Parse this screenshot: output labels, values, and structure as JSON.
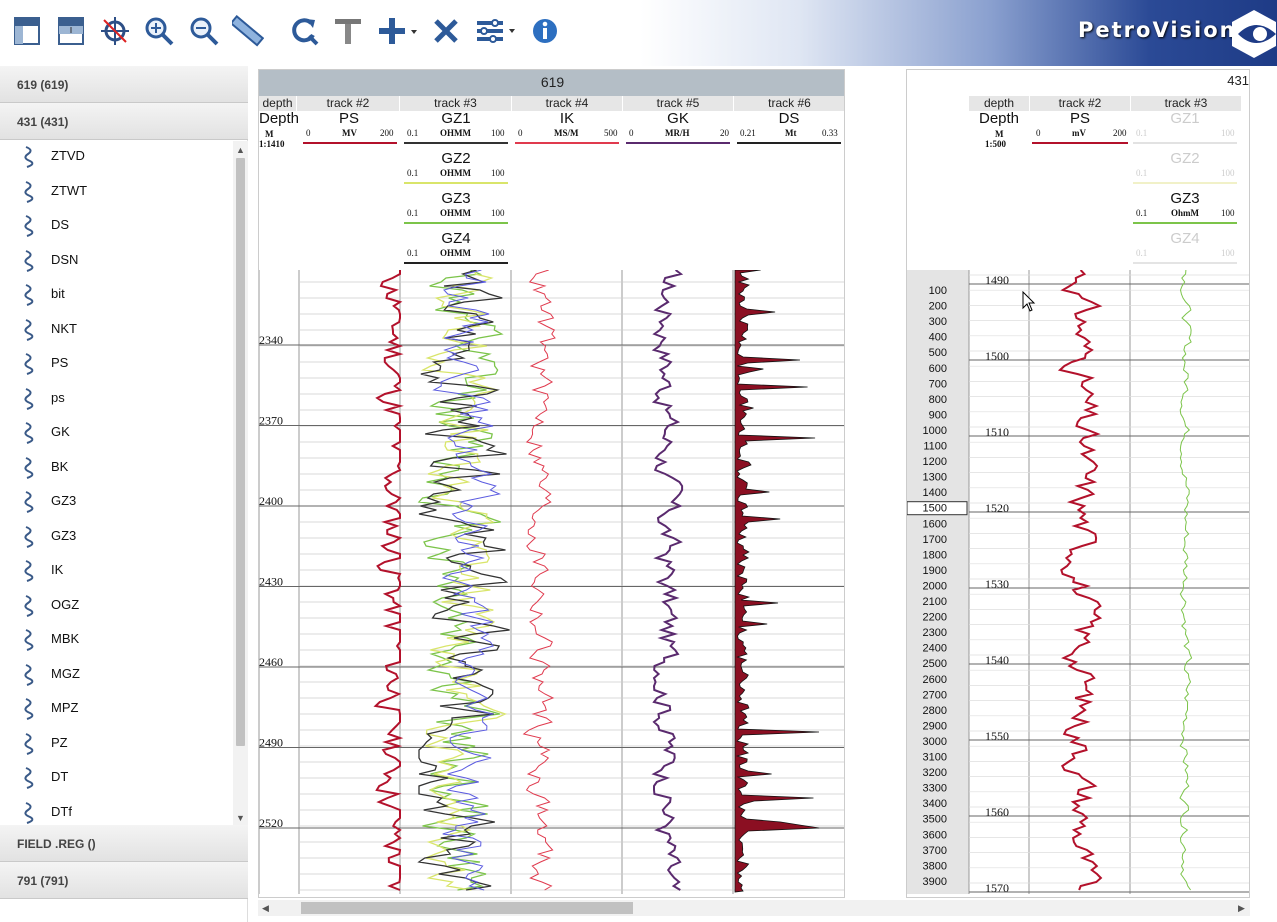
{
  "app": {
    "brand": "PetroVision"
  },
  "toolbar": {
    "icons": [
      "panel-left-icon",
      "panel-top-icon",
      "target-icon",
      "zoom-in-icon",
      "zoom-out-icon",
      "ruler-icon",
      "refresh-icon",
      "align-top-icon",
      "add-icon",
      "close-icon",
      "settings-list-icon",
      "info-icon"
    ]
  },
  "sidebar": {
    "groups": [
      {
        "label": "619 (619)"
      },
      {
        "label": "431 (431)"
      },
      {
        "label": "FIELD .REG ()"
      },
      {
        "label": "791 (791)"
      }
    ],
    "items": [
      "ZTVD",
      "ZTWT",
      "DS",
      "DSN",
      "bit",
      "NKT",
      "PS",
      "ps",
      "GK",
      "BK",
      "GZ3",
      "GZ3",
      "IK",
      "OGZ",
      "MBK",
      "MGZ",
      "MPZ",
      "PZ",
      "DT",
      "DTf"
    ]
  },
  "panel1": {
    "title": "619",
    "tracks": [
      "depth",
      "track #2",
      "track #3",
      "track #4",
      "track #5",
      "track #6"
    ],
    "depth_header": {
      "name": "Depth",
      "unit": "M",
      "scale": "1:1410"
    },
    "curves": [
      {
        "name": "PS",
        "min": "0",
        "unit": "MV",
        "max": "200",
        "color": "#b3112b"
      },
      {
        "name": "GZ1",
        "min": "0.1",
        "unit": "OHMM",
        "max": "100",
        "color": "#333333"
      },
      {
        "name": "GZ2",
        "min": "0.1",
        "unit": "OHMM",
        "max": "100",
        "color": "#d9e56a"
      },
      {
        "name": "GZ3",
        "min": "0.1",
        "unit": "OHMM",
        "max": "100",
        "color": "#7cc44a"
      },
      {
        "name": "GZ4",
        "min": "0.1",
        "unit": "OHMM",
        "max": "100",
        "color": "#222222"
      },
      {
        "name": "IK",
        "min": "0",
        "unit": "MS/M",
        "max": "500",
        "color": "#e03a4e"
      },
      {
        "name": "GK",
        "min": "0",
        "unit": "MR/H",
        "max": "20",
        "color": "#5a2a6e"
      },
      {
        "name": "DS",
        "min": "0.21",
        "unit": "Mt",
        "max": "0.33",
        "color": "#8b0f22"
      }
    ],
    "depth_labels": [
      "2340",
      "2370",
      "2400",
      "2430",
      "2460",
      "2490",
      "2520"
    ]
  },
  "panel2": {
    "title": "431",
    "tracks": [
      "depth",
      "track #2",
      "track #3"
    ],
    "depth_header": {
      "name": "Depth",
      "unit": "M",
      "scale": "1:500"
    },
    "curves": [
      {
        "name": "PS",
        "min": "0",
        "unit": "mV",
        "max": "200",
        "color": "#b3112b"
      },
      {
        "name": "GZ1",
        "min": "0.1",
        "unit": "",
        "max": "100",
        "color": "#d8d8d8"
      },
      {
        "name": "GZ2",
        "min": "0.1",
        "unit": "",
        "max": "100",
        "color": "#f1f1c8"
      },
      {
        "name": "GZ3",
        "min": "0.1",
        "unit": "OhmM",
        "max": "100",
        "color": "#7cc44a"
      },
      {
        "name": "GZ4",
        "min": "0.1",
        "unit": "",
        "max": "100",
        "color": "#dddddd"
      }
    ],
    "overview_labels": [
      "100",
      "200",
      "300",
      "400",
      "500",
      "600",
      "700",
      "800",
      "900",
      "1000",
      "1100",
      "1200",
      "1300",
      "1400",
      "1500",
      "1600",
      "1700",
      "1800",
      "1900",
      "2000",
      "2100",
      "2200",
      "2300",
      "2400",
      "2500",
      "2600",
      "2700",
      "2800",
      "2900",
      "3000",
      "3100",
      "3200",
      "3300",
      "3400",
      "3500",
      "3600",
      "3700",
      "3800",
      "3900"
    ],
    "overview_selected": "1500",
    "depth_labels": [
      "1490",
      "1500",
      "1510",
      "1520",
      "1530",
      "1540",
      "1550",
      "1560",
      "1570"
    ]
  }
}
